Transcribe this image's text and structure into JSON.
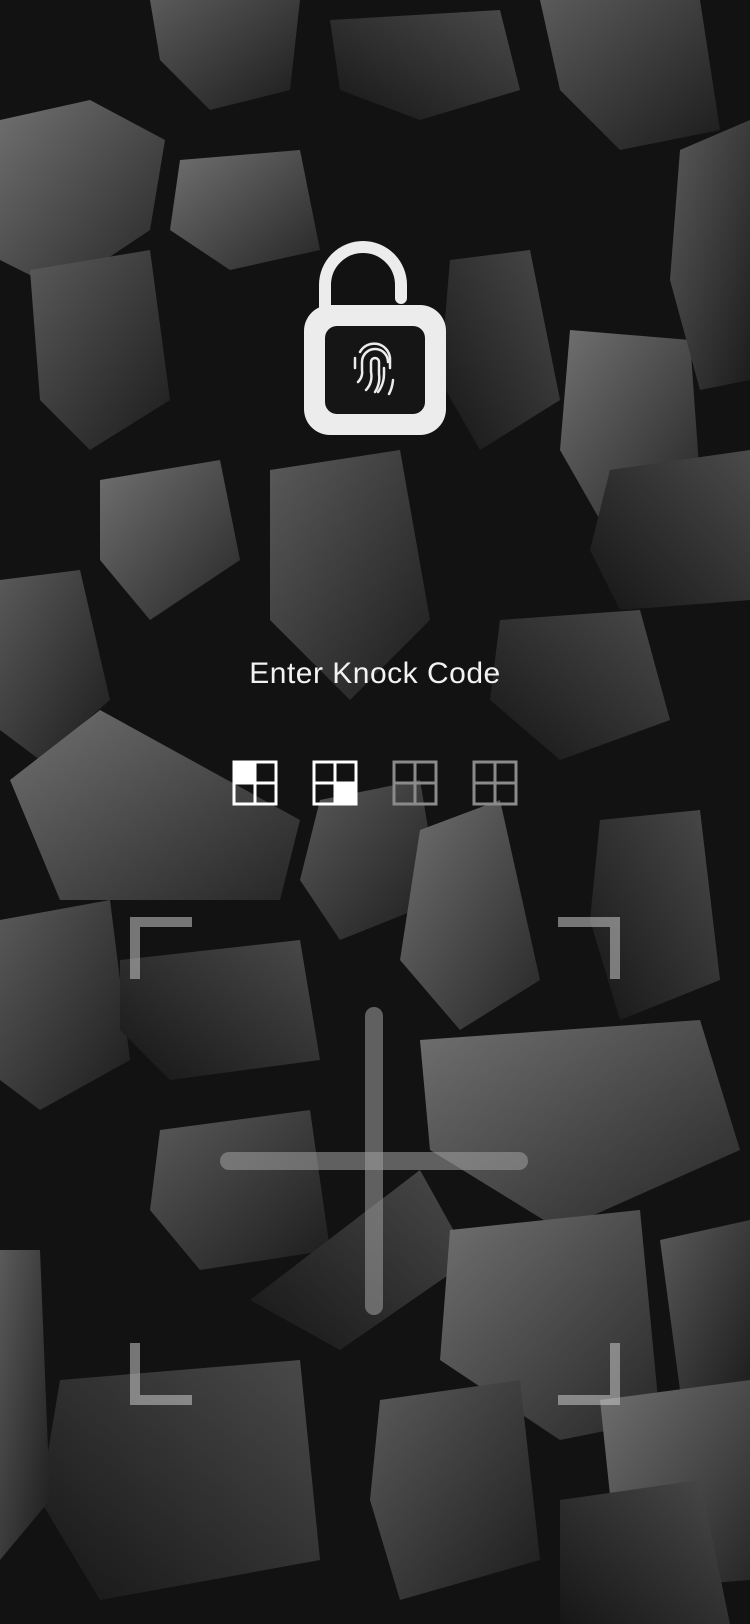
{
  "screen": {
    "title": "Enter Knock Code"
  },
  "lock": {
    "icon": "padlock-fingerprint-icon",
    "state": "unlocked"
  },
  "code_indicators": [
    {
      "slot": 1,
      "filled": true,
      "quadrant": "top-left"
    },
    {
      "slot": 2,
      "filled": true,
      "quadrant": "bottom-right"
    },
    {
      "slot": 3,
      "filled": false
    },
    {
      "slot": 4,
      "filled": false
    }
  ],
  "knock_pad": {
    "quadrants": [
      "top-left",
      "top-right",
      "bottom-left",
      "bottom-right"
    ]
  },
  "colors": {
    "text": "#f2f2f2",
    "accent": "#ffffff",
    "muted": "#8a8a8a"
  }
}
